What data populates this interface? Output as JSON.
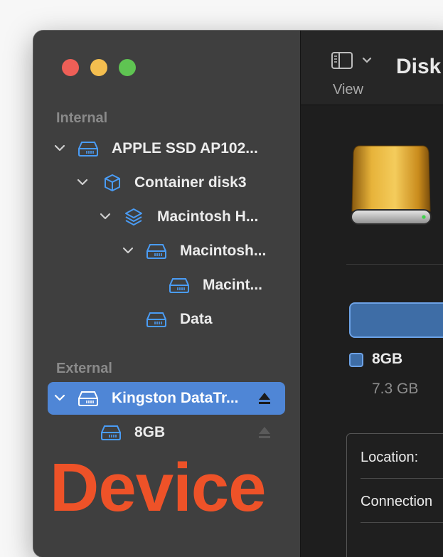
{
  "sidebar": {
    "sections": {
      "internal": "Internal",
      "external": "External"
    },
    "items": [
      {
        "label": "APPLE SSD AP102...",
        "icon": "drive-icon"
      },
      {
        "label": "Container disk3",
        "icon": "container-cube-icon"
      },
      {
        "label": "Macintosh H...",
        "icon": "volume-stack-icon"
      },
      {
        "label": "Macintosh...",
        "icon": "drive-icon"
      },
      {
        "label": "Macint...",
        "icon": "drive-icon"
      },
      {
        "label": "Data",
        "icon": "drive-icon"
      },
      {
        "label": "Kingston DataTr...",
        "icon": "drive-icon",
        "selected": true
      },
      {
        "label": "8GB",
        "icon": "drive-icon"
      }
    ]
  },
  "overlay": {
    "text": "Device",
    "color": "#ee5228"
  },
  "toolbar": {
    "view_label": "View",
    "title": "Disk"
  },
  "main": {
    "legend_name": "8GB",
    "legend_size": "7.3 GB",
    "info": {
      "location_label": "Location:",
      "connection_label": "Connection"
    }
  },
  "colors": {
    "accent": "#4f86d6",
    "icon_blue": "#4a9cf5",
    "usage": "#3e6da6"
  }
}
